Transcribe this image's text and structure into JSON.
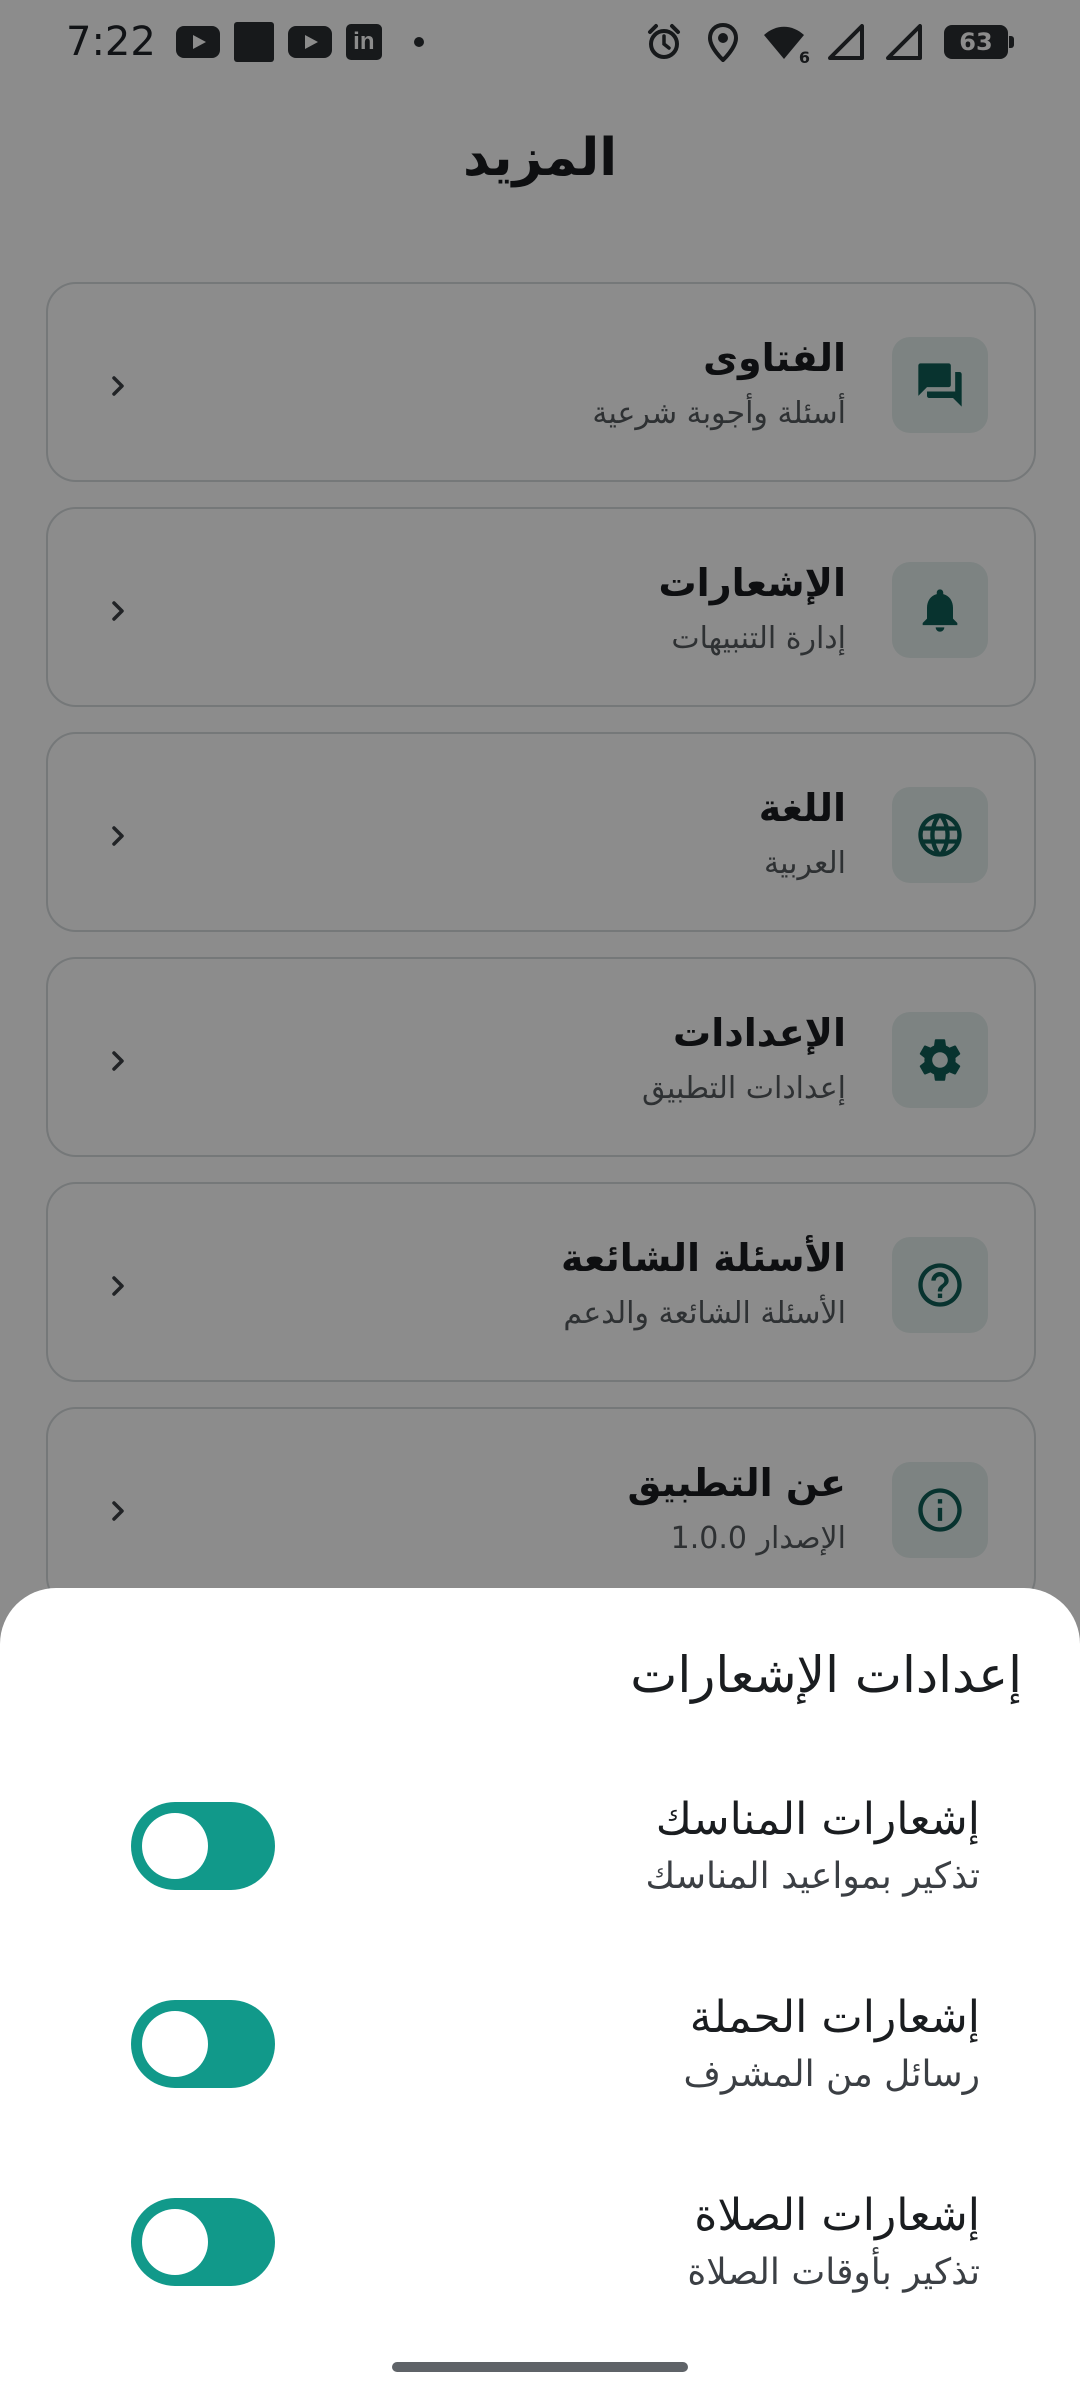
{
  "status_bar": {
    "time": "7:22",
    "left_icons": [
      "youtube-icon",
      "app-square-icon",
      "youtube-icon",
      "linkedin-icon",
      "dot-icon"
    ],
    "linkedin_text": "in",
    "battery": "63",
    "wifi_badge": "6"
  },
  "page": {
    "title": "المزيد"
  },
  "menu": [
    {
      "title": "الفتاوى",
      "subtitle": "أسئلة وأجوبة شرعية",
      "icon": "chat-bubbles-icon"
    },
    {
      "title": "الإشعارات",
      "subtitle": "إدارة التنبيهات",
      "icon": "bell-icon"
    },
    {
      "title": "اللغة",
      "subtitle": "العربية",
      "icon": "globe-icon"
    },
    {
      "title": "الإعدادات",
      "subtitle": "إعدادات التطبيق",
      "icon": "gear-icon"
    },
    {
      "title": "الأسئلة الشائعة",
      "subtitle": "الأسئلة الشائعة والدعم",
      "icon": "help-circle-icon"
    },
    {
      "title": "عن التطبيق",
      "subtitle": "الإصدار 1.0.0",
      "icon": "info-circle-icon"
    }
  ],
  "sheet": {
    "title": "إعدادات الإشعارات",
    "settings": [
      {
        "title": "إشعارات المناسك",
        "subtitle": "تذكير بمواعيد المناسك",
        "enabled": true
      },
      {
        "title": "إشعارات الحملة",
        "subtitle": "رسائل من المشرف",
        "enabled": true
      },
      {
        "title": "إشعارات الصلاة",
        "subtitle": "تذكير بأوقات الصلاة",
        "enabled": true
      }
    ]
  },
  "colors": {
    "accent": "#11998a",
    "icon_box_bg": "#e3efed",
    "icon_color": "#0f5e56",
    "card_border": "#d6dadd",
    "scrim": "rgba(0,0,0,0.45)"
  }
}
